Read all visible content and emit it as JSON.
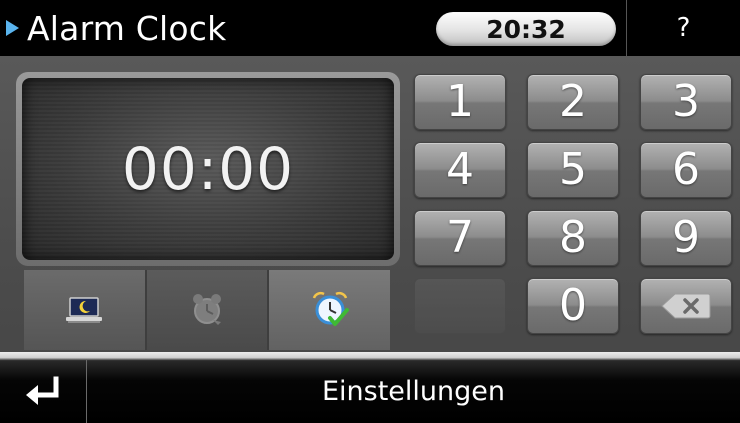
{
  "header": {
    "title": "Alarm Clock",
    "current_time": "20:32",
    "help_label": "?"
  },
  "display": {
    "time": "00:00"
  },
  "modes": [
    {
      "icon": "moon-laptop-icon"
    },
    {
      "icon": "alarm-clock-off-icon"
    },
    {
      "icon": "alarm-clock-check-icon"
    }
  ],
  "keypad": {
    "keys": [
      "1",
      "2",
      "3",
      "4",
      "5",
      "6",
      "7",
      "8",
      "9",
      "0"
    ],
    "backspace_icon": "backspace-icon"
  },
  "footer": {
    "label": "Einstellungen",
    "back_icon": "return-arrow-icon"
  },
  "colors": {
    "accent": "#5ab4ee",
    "check": "#3fb934"
  }
}
